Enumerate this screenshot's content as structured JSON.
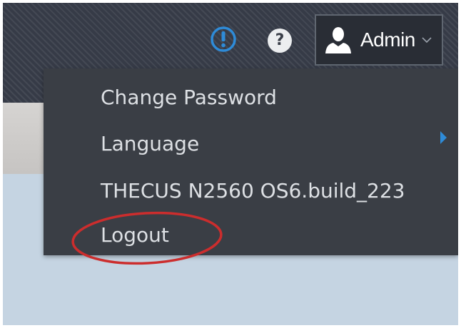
{
  "header": {
    "info_icon": "alert-circle-icon",
    "help_icon": "question-circle-icon",
    "user_menu": {
      "icon": "user-silhouette-icon",
      "label": "Admin",
      "caret_icon": "chevron-down-icon"
    }
  },
  "dropdown": {
    "items": [
      {
        "label": "Change Password"
      },
      {
        "label": "Language",
        "submenu_icon": "chevron-right-icon"
      },
      {
        "label": "THECUS N2560 OS6.build_223"
      },
      {
        "label": "Logout"
      }
    ]
  },
  "annotation": {
    "shape": "ellipse",
    "target": "Logout"
  },
  "colors": {
    "topbar_bg": "#363b47",
    "menu_bg": "#3a3e45",
    "menu_text": "#dde0e4",
    "info_blue": "#2e8bd8",
    "annotation_red": "#cc2d2d",
    "content_bg": "#c5d4e2"
  }
}
